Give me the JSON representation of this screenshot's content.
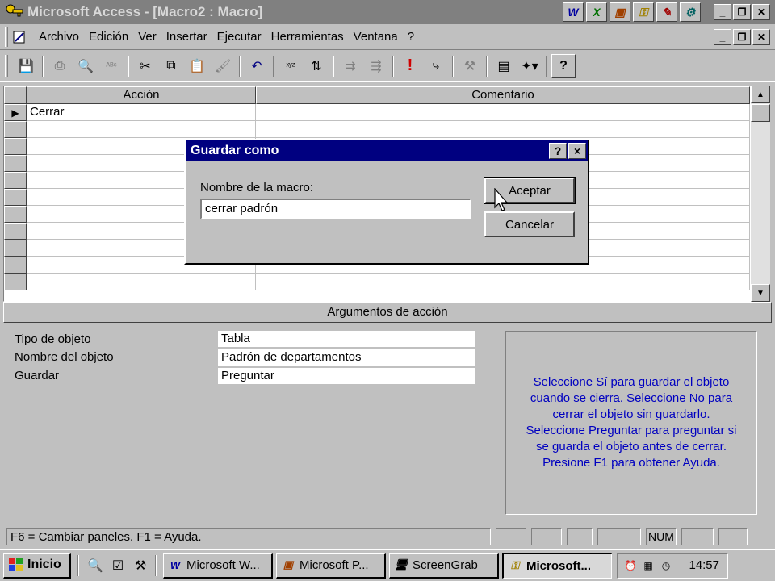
{
  "window": {
    "title": "Microsoft Access - [Macro2 : Macro]"
  },
  "office_bar": {
    "icons": [
      "word-icon",
      "excel-icon",
      "powerpoint-icon",
      "access-icon",
      "schedule-icon",
      "binder-icon"
    ]
  },
  "menu": {
    "items": [
      "Archivo",
      "Edición",
      "Ver",
      "Insertar",
      "Ejecutar",
      "Herramientas",
      "Ventana",
      "?"
    ]
  },
  "grid": {
    "headers": {
      "action": "Acción",
      "comment": "Comentario"
    },
    "rows": [
      {
        "action": "Cerrar",
        "comment": ""
      }
    ]
  },
  "args": {
    "header": "Argumentos de acción",
    "fields": [
      {
        "label": "Tipo de objeto",
        "value": "Tabla"
      },
      {
        "label": "Nombre del objeto",
        "value": "Padrón de departamentos"
      },
      {
        "label": "Guardar",
        "value": "Preguntar"
      }
    ],
    "help_lines": [
      "Seleccione Sí para guardar el objeto",
      "cuando se cierra. Seleccione No para",
      "cerrar el objeto sin guardarlo.",
      "Seleccione Preguntar para preguntar si",
      "se guarda el objeto antes de cerrar.",
      "Presione F1 para obtener Ayuda."
    ]
  },
  "dialog": {
    "title": "Guardar como",
    "label": "Nombre de la macro:",
    "value": "cerrar padrón",
    "ok": "Aceptar",
    "cancel": "Cancelar",
    "help_btn": "?",
    "close_btn": "×"
  },
  "status": {
    "text": "F6 = Cambiar paneles.  F1 = Ayuda.",
    "num": "NUM"
  },
  "taskbar": {
    "start": "Inicio",
    "buttons": [
      {
        "label": "Microsoft W...",
        "active": false
      },
      {
        "label": "Microsoft P...",
        "active": false
      },
      {
        "label": "ScreenGrab",
        "active": false
      },
      {
        "label": "Microsoft...",
        "active": true
      }
    ],
    "clock": "14:57"
  },
  "colors": {
    "titlebar_inactive": "#808080",
    "dialog_title": "#000080",
    "help_text": "#0000c0",
    "face": "#c0c0c0"
  }
}
